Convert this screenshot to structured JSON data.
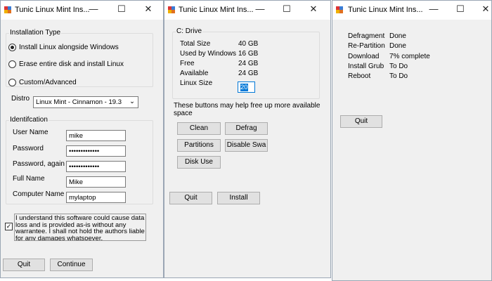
{
  "window_title": "Tunic Linux Mint Ins...",
  "controls": {
    "minimize": "—",
    "maximize": "☐",
    "close": "✕"
  },
  "colors": {
    "selection": "#0078d7",
    "titlebar": "#ffffff",
    "body": "#f0f0f0"
  },
  "w1": {
    "install_type_label": "Installation Type",
    "options": [
      "Install Linux alongside Windows",
      "Erase entire disk and install Linux",
      "Custom/Advanced"
    ],
    "selected_option": 0,
    "distro_label": "Distro",
    "distro_value": "Linux Mint - Cinnamon - 19.3",
    "ident_label": "Identifcation",
    "fields": [
      {
        "label": "User Name",
        "value": "mike"
      },
      {
        "label": "Password",
        "value": "•••••••••••••"
      },
      {
        "label": "Password, again",
        "value": "•••••••••••••"
      },
      {
        "label": "Full Name",
        "value": "Mike"
      },
      {
        "label": "Computer Name",
        "value": "mylaptop"
      }
    ],
    "agree_checked": true,
    "agree_text": "I understand this software could cause data loss and is provided as-is without any warrantee.  I shall not hold the authors liable for any damages whatsoever.",
    "quit": "Quit",
    "continue": "Continue"
  },
  "w2": {
    "drive_label": "C: Drive",
    "rows": [
      {
        "label": "Total Size",
        "value": "40 GB"
      },
      {
        "label": "Used by Windows",
        "value": "16 GB"
      },
      {
        "label": "Free",
        "value": "24 GB"
      },
      {
        "label": "Available",
        "value": "24 GB"
      }
    ],
    "linux_size_label": "Linux Size",
    "linux_size_value": "20",
    "hint": "These buttons may help free up more available space",
    "buttons": [
      "Clean",
      "Defrag",
      "Partitions",
      "Disable Swa",
      "Disk Use"
    ],
    "quit": "Quit",
    "install": "Install"
  },
  "w3": {
    "steps": [
      {
        "label": "Defragment",
        "status": "Done"
      },
      {
        "label": "Re-Partition",
        "status": "Done"
      },
      {
        "label": "Download",
        "status": "7% complete"
      },
      {
        "label": "Install Grub",
        "status": "To Do"
      },
      {
        "label": "Reboot",
        "status": "To Do"
      }
    ],
    "quit": "Quit"
  }
}
